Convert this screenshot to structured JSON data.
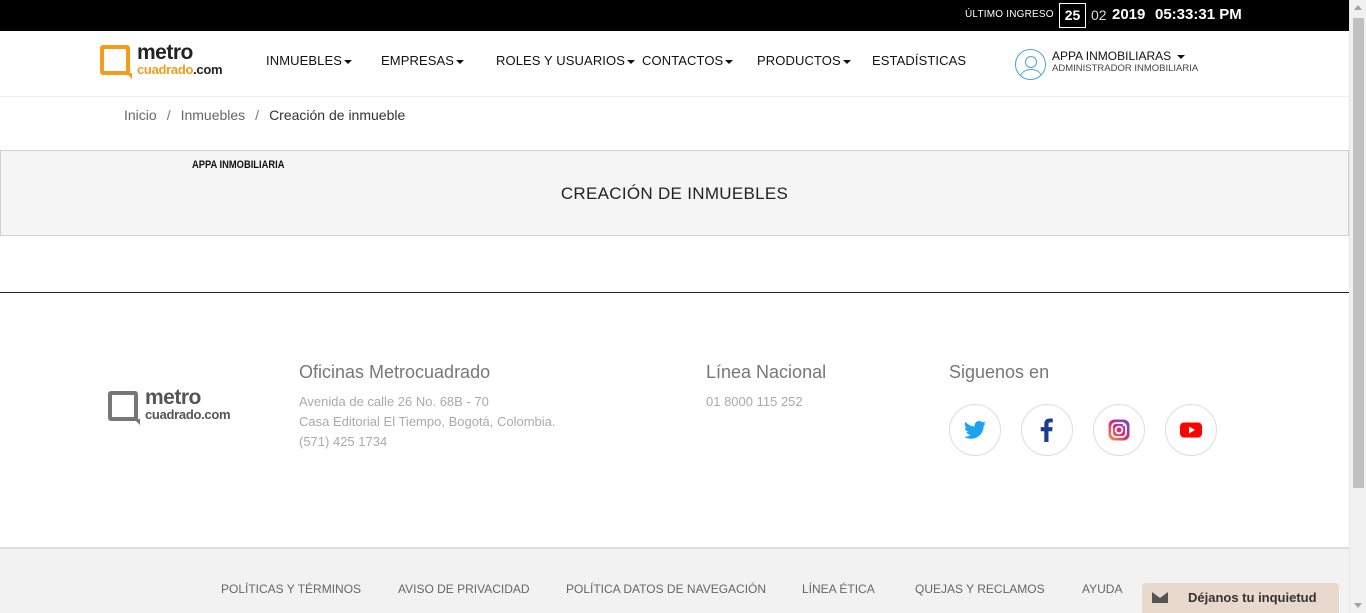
{
  "topbar": {
    "label": "ÚLTIMO INGRESO",
    "day": "25",
    "month": "02",
    "year": "2019",
    "time": "05:33:31 PM"
  },
  "logo": {
    "word1": "metro",
    "word2": "cuadrado",
    "word3": ".com"
  },
  "nav": {
    "items": [
      {
        "label": "INMUEBLES",
        "dropdown": true
      },
      {
        "label": "EMPRESAS",
        "dropdown": true
      },
      {
        "label": "ROLES Y USUARIOS",
        "dropdown": true
      },
      {
        "label": "CONTACTOS",
        "dropdown": true
      },
      {
        "label": "PRODUCTOS",
        "dropdown": true
      },
      {
        "label": "ESTADÍSTICAS",
        "dropdown": false
      }
    ]
  },
  "user": {
    "name": "APPA INMOBILIARAS",
    "role": "ADMINISTRADOR INMOBILIARIA",
    "icon": "user-avatar-icon"
  },
  "breadcrumb": {
    "items": [
      "Inicio",
      "Inmuebles",
      "Creación de inmueble"
    ],
    "separator": "/"
  },
  "panel": {
    "company": "APPA INMOBILIARIA",
    "title": "CREACIÓN DE INMUEBLES"
  },
  "footer": {
    "offices_title": "Oficinas Metrocuadrado",
    "address_line1": "Avenida de calle 26 No. 68B - 70",
    "address_line2": "Casa Editorial El Tiempo, Bogotá, Colombia.",
    "phone": "(571) 425 1734",
    "national_title": "Línea Nacional",
    "national_phone": "01 8000 115 252",
    "social_title": "Siguenos en",
    "social": [
      {
        "name": "twitter-icon",
        "color": "#1da1f2"
      },
      {
        "name": "facebook-icon",
        "color": "#3b5998"
      },
      {
        "name": "instagram-icon",
        "color": "#c13584"
      },
      {
        "name": "youtube-icon",
        "color": "#ff0000"
      }
    ],
    "links": [
      "POLÍTICAS Y TÉRMINOS",
      "AVISO DE PRIVACIDAD",
      "POLÍTICA DATOS DE NAVEGACIÓN",
      "LÍNEA ÉTICA",
      "QUEJAS Y RECLAMOS",
      "AYUDA"
    ]
  },
  "feedback": {
    "label": "Déjanos tu inquietud",
    "icon": "envelope-icon"
  },
  "colors": {
    "brand_orange": "#f59c1a",
    "topbar": "#000000",
    "panel_bg": "#f5f5f5"
  }
}
